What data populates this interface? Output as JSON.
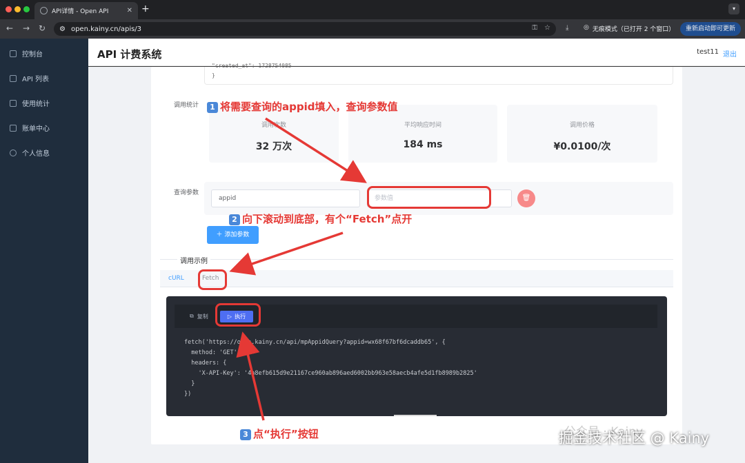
{
  "browser": {
    "tab_title": "API详情 - Open API",
    "url": "open.kainy.cn/apis/3",
    "incognito": "无痕模式（已打开 2 个窗口）",
    "update_button": "重新启动即可更新"
  },
  "sidebar": {
    "items": [
      {
        "label": "控制台"
      },
      {
        "label": "API 列表"
      },
      {
        "label": "使用统计"
      },
      {
        "label": "账单中心"
      },
      {
        "label": "个人信息"
      }
    ]
  },
  "header": {
    "title": "API 计费系统",
    "user": "test11",
    "logout": "退出"
  },
  "code_top": {
    "line1": "\"created_at\": 1728754085",
    "line2": "}"
  },
  "stats": {
    "label": "调用统计",
    "items": [
      {
        "label": "调用次数",
        "value": "32 万次"
      },
      {
        "label": "平均响应时间",
        "value": "184 ms"
      },
      {
        "label": "调用价格",
        "value": "¥0.0100/次"
      }
    ]
  },
  "query": {
    "label": "查询参数",
    "key_value": "appid",
    "value_placeholder": "参数值",
    "add_button": "添加参数"
  },
  "example": {
    "title": "调用示例",
    "tabs": [
      "cURL",
      "Fetch"
    ],
    "copy": "复制",
    "run": "执行",
    "code": "fetch('https://open.kainy.cn/api/mpAppidQuery?appid=wx68f67bf6dcaddb65', {\n  method: 'GET',\n  headers: {\n    'X-API-Key': '4a8efb615d9e21167ce960ab896aed6002bb963e58aecb4afe5d1fb8989b2825'\n  }\n})"
  },
  "annotations": {
    "step1": {
      "num": "1",
      "text": "将需要查询的appid填入，查询参数值"
    },
    "step2": {
      "num": "2",
      "text": "向下滚动到底部，有个“Fetch”点开"
    },
    "step3": {
      "num": "3",
      "text": "点“执行”按钮"
    }
  },
  "watermark": {
    "main": "掘金技术社区 @ Kainy",
    "faint": "公众号 · Kainy"
  },
  "colors": {
    "accent": "#409eff",
    "annotation": "#e53935",
    "sidebar": "#1f2d3d"
  }
}
